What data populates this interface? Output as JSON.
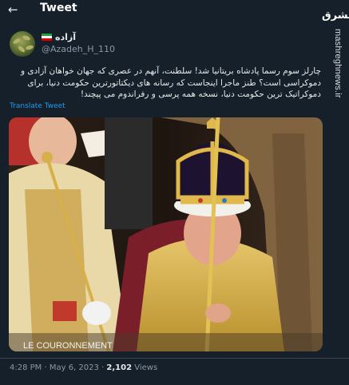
{
  "header": {
    "back_icon": "arrow-left-icon",
    "title": "Tweet"
  },
  "author": {
    "display_name": "آزاده",
    "flag_icon": "iran-flag-icon",
    "handle": "@Azadeh_H_110"
  },
  "tweet": {
    "text": "چارلز سوم رسما پادشاه بریتانیا شد! سلطنت، آنهم در عصری که جهان خواهان آزادی و دموکراسی است؟ طنز ماجرا اینجاست که رسانه های دیکتاتورترین حکومت دنیا، برای دموکراتیک ترین حکومت دنیا، نسخه همه پرسی و رفراندوم می پیچند!",
    "translate_label": "Translate Tweet",
    "media_caption": "LE COURONNEMENT",
    "time": "4:28 PM",
    "date": "May 6, 2023",
    "views_count": "2,102",
    "views_label": "Views"
  },
  "watermark": {
    "logo": "مشرق",
    "url": "mashreghnews.ir"
  },
  "colors": {
    "background": "#15202b",
    "link": "#1d9bf0",
    "muted": "#8b98a5"
  }
}
